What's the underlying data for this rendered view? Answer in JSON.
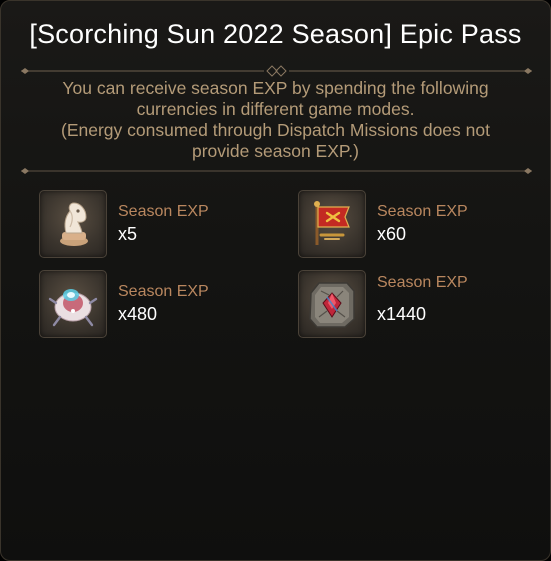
{
  "header": {
    "title": "[Scorching Sun 2022 Season] Epic Pass"
  },
  "description": {
    "line1": "You can receive season EXP by spending the following",
    "line2": "currencies in different game modes.",
    "line3": "(Energy consumed through Dispatch Missions does not",
    "line4": "provide season EXP.)"
  },
  "items": [
    {
      "icon": "chess-knight-icon",
      "label": "Season EXP",
      "value": "x5"
    },
    {
      "icon": "war-banner-icon",
      "label": "Season EXP",
      "value": "x60"
    },
    {
      "icon": "spaceship-disc-icon",
      "label": "Season EXP",
      "value": "x480"
    },
    {
      "icon": "stone-tablet-gem-icon",
      "label": "Season EXP",
      "value": "x1440"
    }
  ],
  "colors": {
    "title": "#ffffff",
    "description": "#b49b78",
    "item_label": "#b9875f",
    "item_value": "#ffffff",
    "divider": "#7b6a55"
  }
}
